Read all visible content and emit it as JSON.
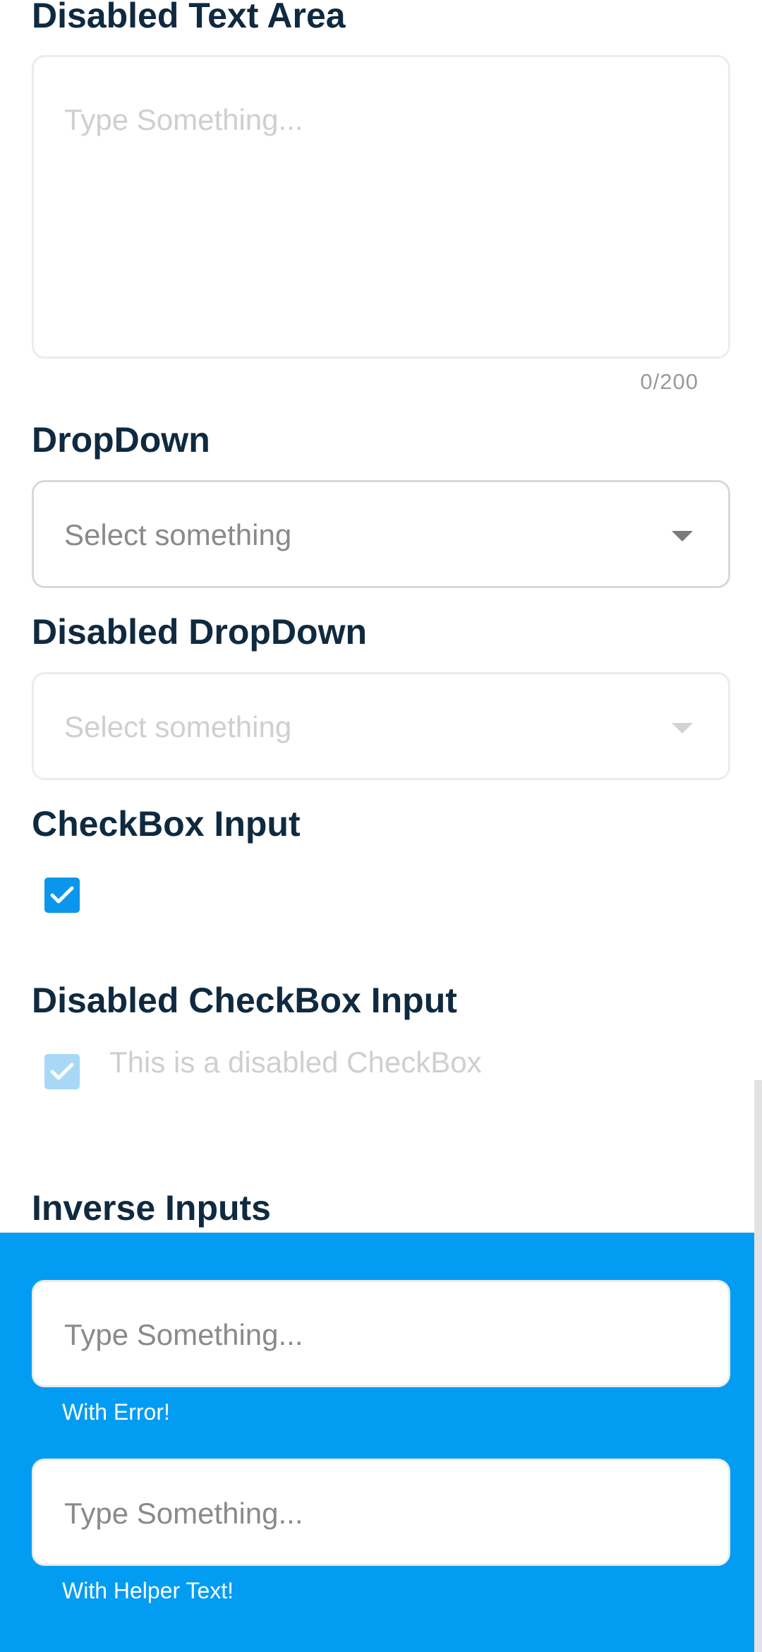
{
  "sections": {
    "disabled_text_area": {
      "title": "Disabled Text Area",
      "placeholder": "Type Something...",
      "counter": "0/200"
    },
    "dropdown": {
      "title": "DropDown",
      "placeholder": "Select something",
      "caret_icon": "caret-down-icon"
    },
    "disabled_dropdown": {
      "title": "Disabled DropDown",
      "placeholder": "Select something",
      "caret_icon": "caret-down-icon"
    },
    "checkbox": {
      "title": "CheckBox Input",
      "checked": true
    },
    "disabled_checkbox": {
      "title": "Disabled CheckBox Input",
      "checked": true,
      "label": "This is a disabled CheckBox"
    },
    "inverse_inputs": {
      "title": "Inverse Inputs",
      "fields": [
        {
          "placeholder": "Type Something...",
          "helper": "With Error!"
        },
        {
          "placeholder": "Type Something...",
          "helper": "With Helper Text!"
        }
      ]
    }
  },
  "colors": {
    "heading": "#0f2a40",
    "accent": "#0b95eb",
    "inverse_background": "#039cf3",
    "disabled_accent": "#a9d8f7"
  }
}
